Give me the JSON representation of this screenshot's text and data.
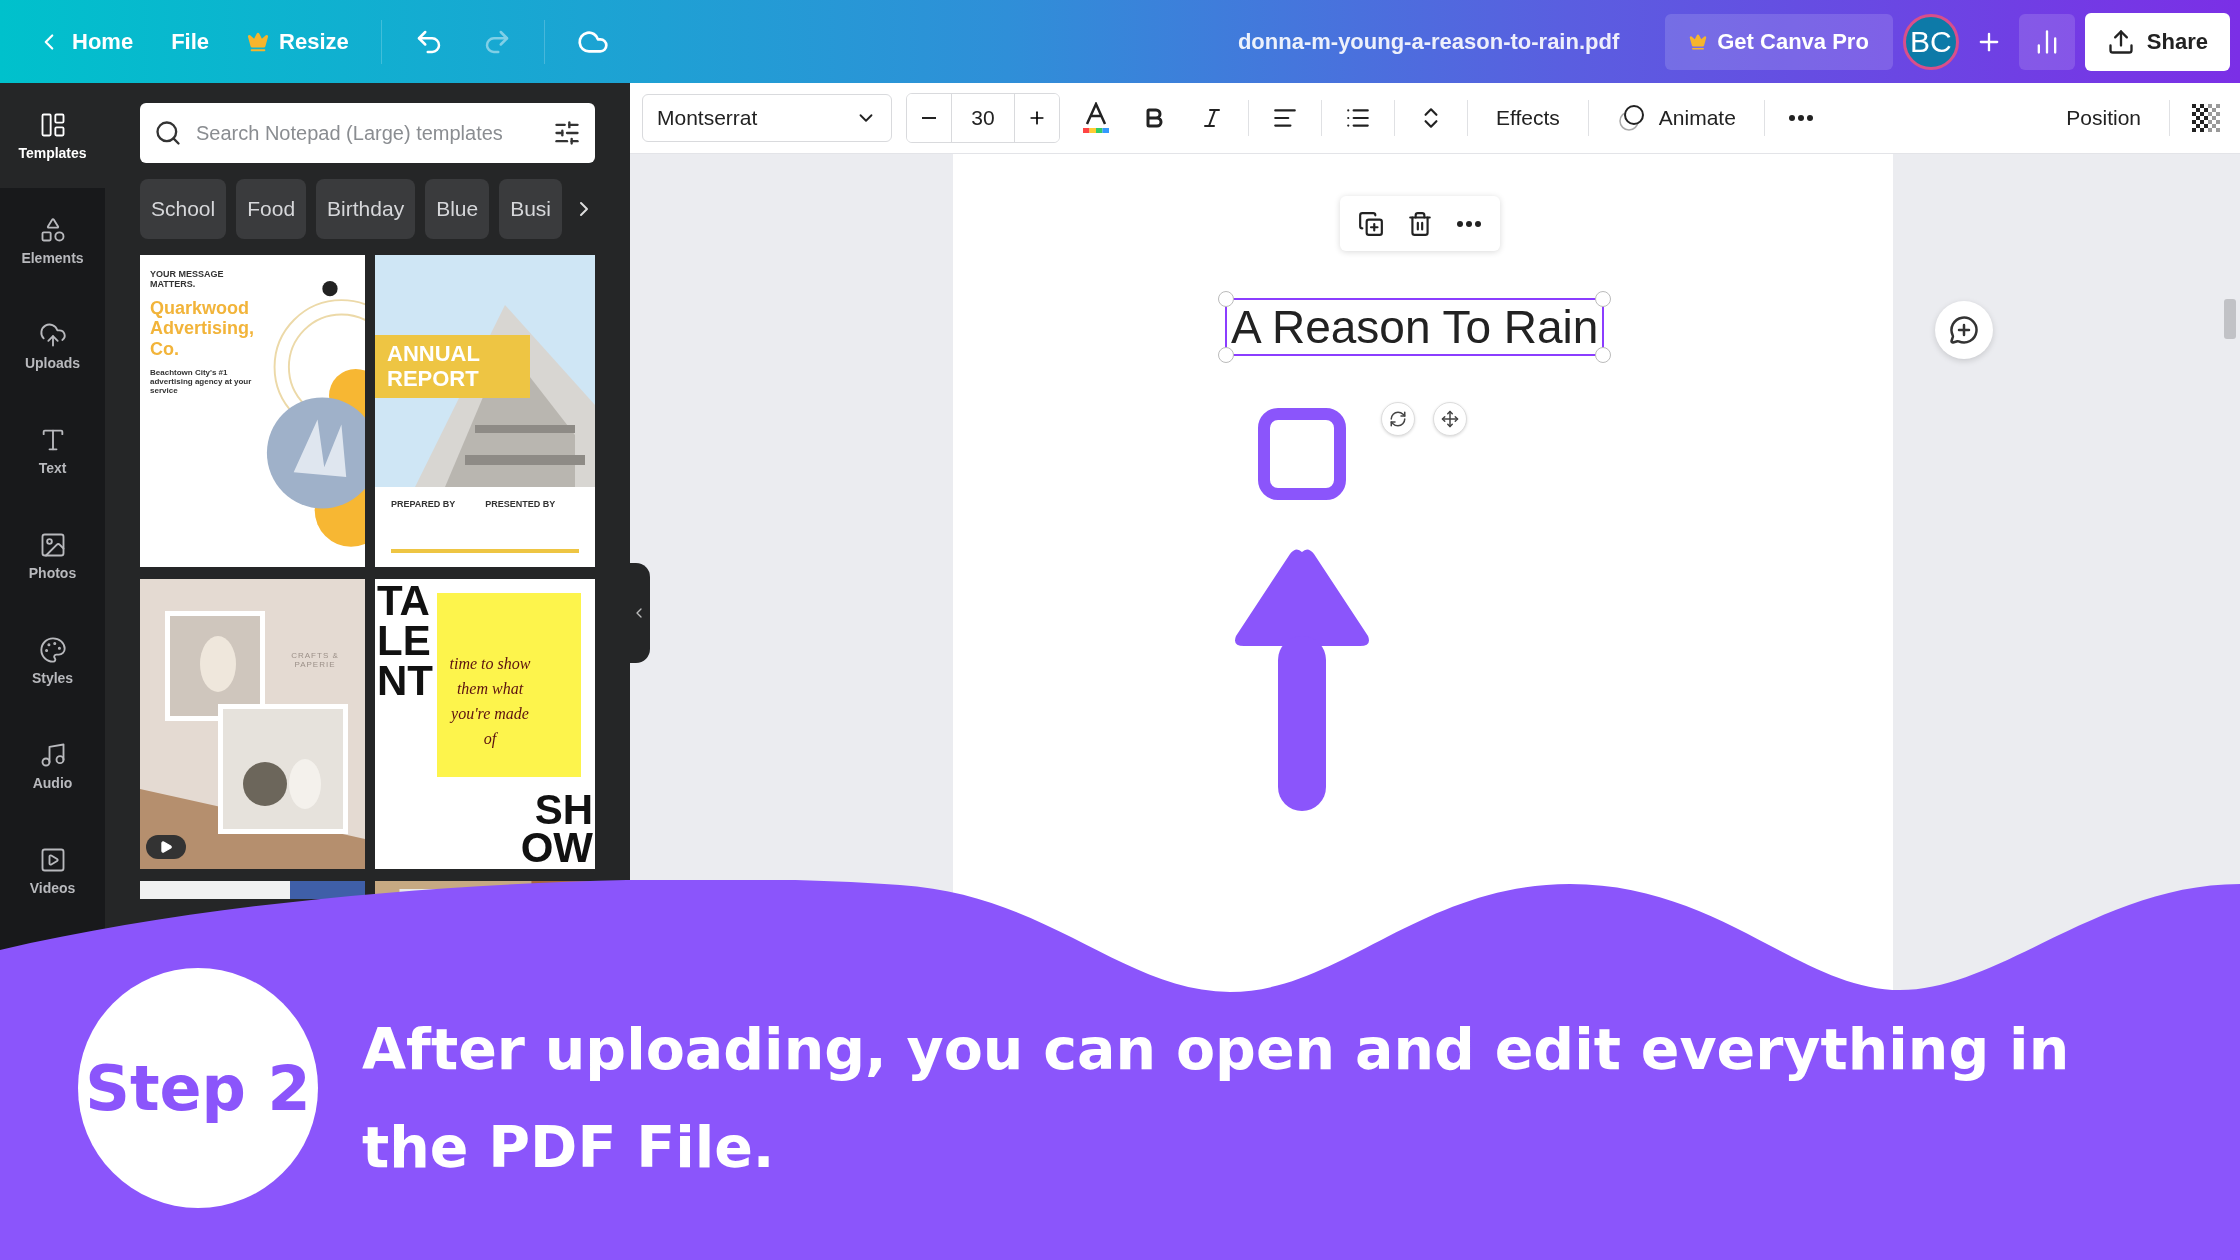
{
  "top_bar": {
    "home": "Home",
    "file": "File",
    "resize": "Resize",
    "file_name": "donna-m-young-a-reason-to-rain.pdf",
    "pro_button": "Get Canva Pro",
    "avatar": "BC",
    "share": "Share"
  },
  "side_nav": [
    {
      "label": "Templates",
      "selected": true
    },
    {
      "label": "Elements",
      "selected": false
    },
    {
      "label": "Uploads",
      "selected": false
    },
    {
      "label": "Text",
      "selected": false
    },
    {
      "label": "Photos",
      "selected": false
    },
    {
      "label": "Styles",
      "selected": false
    },
    {
      "label": "Audio",
      "selected": false
    },
    {
      "label": "Videos",
      "selected": false
    }
  ],
  "template_panel": {
    "search_placeholder": "Search Notepad (Large) templates",
    "chips": [
      "School",
      "Food",
      "Birthday",
      "Blue",
      "Busi"
    ],
    "templates": [
      {
        "kind": "flyer",
        "eyebrow": "YOUR MESSAGE MATTERS.",
        "title": "Quarkwood Advertising, Co.",
        "tagline": "Beachtown City's #1 advertising agency at your service"
      },
      {
        "kind": "report",
        "title": "ANNUAL REPORT",
        "labels": [
          "PREPARED BY",
          "PRESENTED BY"
        ]
      },
      {
        "kind": "moodboard",
        "brand": "CRAFTS & PAPERIE",
        "video": true
      },
      {
        "kind": "poster",
        "top_lines": [
          "TA",
          "LE",
          "NT"
        ],
        "body": "time to show them what you're made of",
        "bottom_lines": [
          "SH",
          "OW"
        ]
      },
      {
        "kind": "picture"
      },
      {
        "kind": "picture"
      }
    ]
  },
  "toolbar": {
    "font": "Montserrat",
    "font_size": "30",
    "effects": "Effects",
    "animate": "Animate",
    "position": "Position"
  },
  "canvas": {
    "text": "A Reason To Rain"
  },
  "banner": {
    "step": "Step 2",
    "caption": "After uploading, you can open and edit everything in the PDF File."
  }
}
